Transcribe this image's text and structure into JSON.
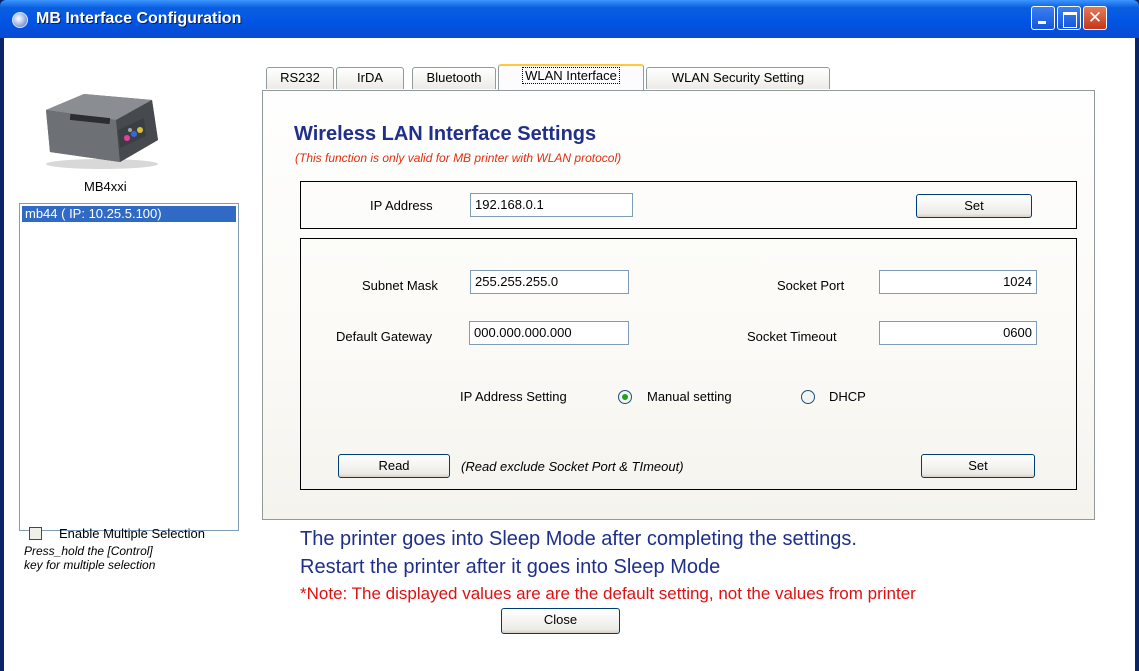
{
  "window": {
    "title": "MB Interface Configuration"
  },
  "sidebar": {
    "model_label": "MB4xxi",
    "devices": [
      {
        "label": "mb44 ( IP: 10.25.5.100)"
      }
    ],
    "enable_multiple_selection_label": "Enable Multiple Selection",
    "enable_multiple_selection_checked": false,
    "hint_line1": "Press_hold the [Control]",
    "hint_line2": "key for multiple selection"
  },
  "tabs": [
    {
      "label": "RS232",
      "active": false
    },
    {
      "label": "IrDA",
      "active": false
    },
    {
      "label": "Bluetooth",
      "active": false
    },
    {
      "label": "WLAN Interface",
      "active": true
    },
    {
      "label": "WLAN Security Setting",
      "active": false
    }
  ],
  "panel": {
    "title": "Wireless LAN Interface Settings",
    "subtitle": "(This function is only valid for MB printer with WLAN protocol)",
    "ip_address_label": "IP Address",
    "ip_address_value": "192.168.0.1",
    "ip_set_label": "Set",
    "subnet_mask_label": "Subnet Mask",
    "subnet_mask_value": "255.255.255.0",
    "default_gateway_label": "Default Gateway",
    "default_gateway_value": "000.000.000.000",
    "socket_port_label": "Socket Port",
    "socket_port_value": "1024",
    "socket_timeout_label": "Socket Timeout",
    "socket_timeout_value": "0600",
    "ip_setting_label": "IP Address Setting",
    "manual_setting_label": "Manual setting",
    "dhcp_label": "DHCP",
    "ip_setting_selected": "Manual setting",
    "read_label": "Read",
    "read_note": "(Read exclude Socket Port & TImeout)",
    "set_label": "Set"
  },
  "messages": {
    "line1": "The printer goes into Sleep Mode after completing the settings.",
    "line2": "Restart the printer after it goes into Sleep Mode",
    "note": "*Note: The displayed values are  are the default setting, not the values from printer"
  },
  "footer": {
    "close_label": "Close"
  },
  "colors": {
    "title_blue": "#1f2f8a",
    "note_red": "#e01010",
    "subtitle_red": "#e03010",
    "selection_blue": "#316ac5"
  }
}
